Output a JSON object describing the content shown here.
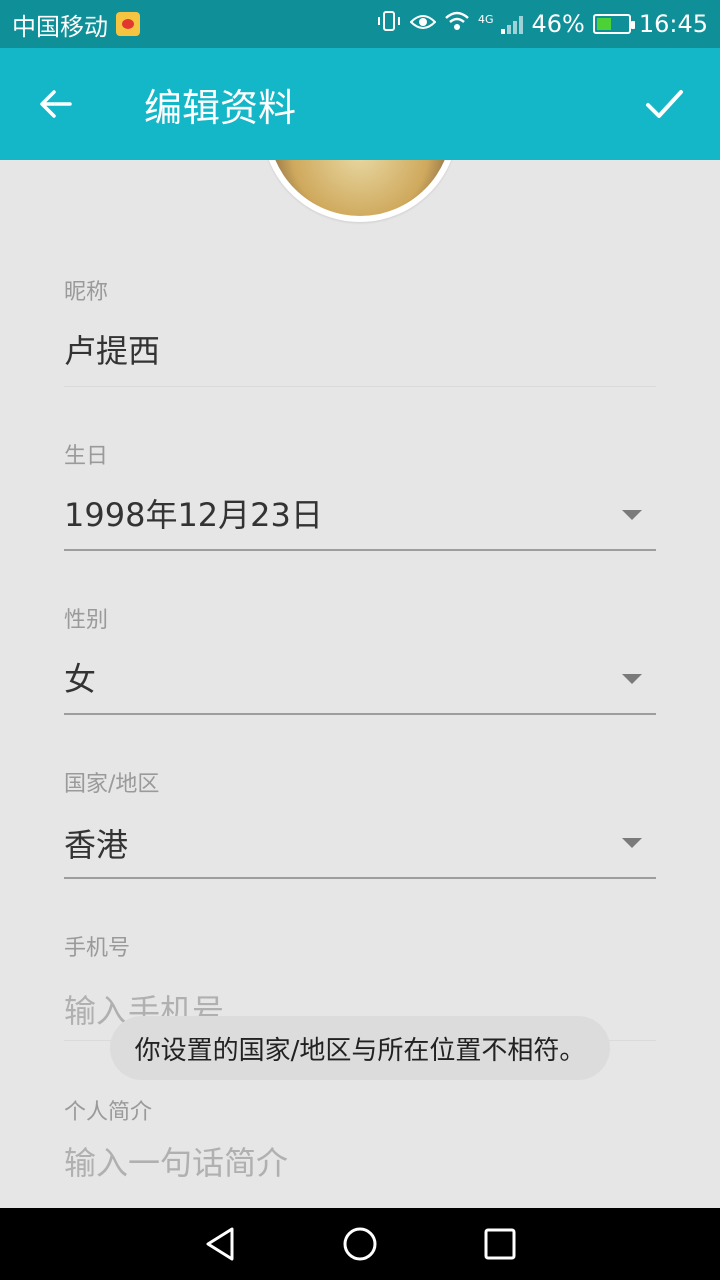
{
  "status_bar": {
    "carrier": "中国移动",
    "network": "4G",
    "battery_percent": "46%",
    "battery_level": 0.46,
    "time": "16:45",
    "icons": [
      "weibo-icon",
      "vibrate-icon",
      "eye-icon",
      "wifi-icon",
      "signal-icon",
      "battery-icon"
    ]
  },
  "app_bar": {
    "title": "编辑资料",
    "back_icon": "arrow-left-icon",
    "done_icon": "check-icon"
  },
  "form": {
    "nickname": {
      "label": "昵称",
      "value": "卢提西"
    },
    "birthday": {
      "label": "生日",
      "value": "1998年12月23日"
    },
    "gender": {
      "label": "性别",
      "value": "女"
    },
    "region": {
      "label": "国家/地区",
      "value": "香港"
    },
    "phone": {
      "label": "手机号",
      "placeholder": "输入手机号"
    },
    "bio": {
      "label": "个人简介",
      "placeholder": "输入一句话简介"
    }
  },
  "toast": {
    "message": "你设置的国家/地区与所在位置不相符。"
  },
  "nav_bar": {
    "icons": [
      "back-triangle-icon",
      "home-circle-icon",
      "recents-square-icon"
    ]
  },
  "colors": {
    "accent": "#14b7c7",
    "status_bar": "#0f8f98",
    "background": "#e6e6e6"
  }
}
